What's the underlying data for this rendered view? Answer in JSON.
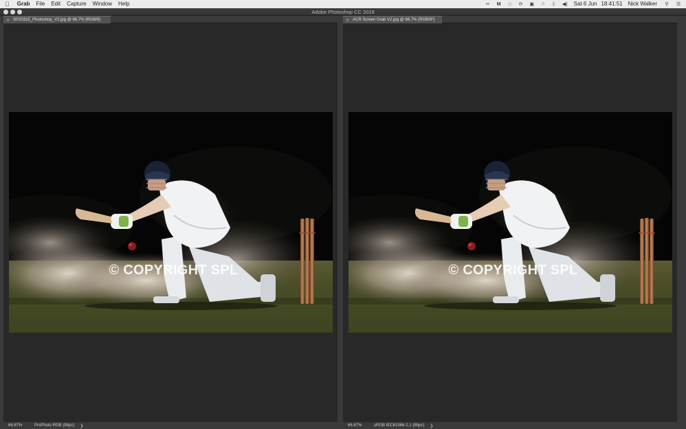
{
  "menubar": {
    "apple_icon": "apple-logo",
    "items": [
      "Grab",
      "File",
      "Edit",
      "Capture",
      "Window",
      "Help"
    ],
    "date": "Sat 6 Jun",
    "time": "18:41:51",
    "user": "Nick Walker",
    "status_icons": [
      "scissors-icon",
      "malwarebytes-icon",
      "clock-icon",
      "sync-icon",
      "camera-icon",
      "time-machine-icon",
      "bluetooth-icon",
      "volume-icon"
    ]
  },
  "app": {
    "title": "Adobe Photoshop CC 2018"
  },
  "documents": [
    {
      "tab_title": "SP20315_Photoshop_V2.jpg @ 66.7% (RGB/8)",
      "zoom": "66.67%",
      "profile": "ProPhoto RGB (8bpc)",
      "watermark": "© COPYRIGHT SPL"
    },
    {
      "tab_title": "ACR Screen Grab V2.jpg @ 66.7% (RGB/8*)",
      "zoom": "66.67%",
      "profile": "sRGB IEC61966-2.1 (8bpc)",
      "watermark": "© COPYRIGHT SPL"
    }
  ],
  "colors": {
    "menubar": "#ececec",
    "canvas": "#282828",
    "panel": "#3a3a3a"
  }
}
